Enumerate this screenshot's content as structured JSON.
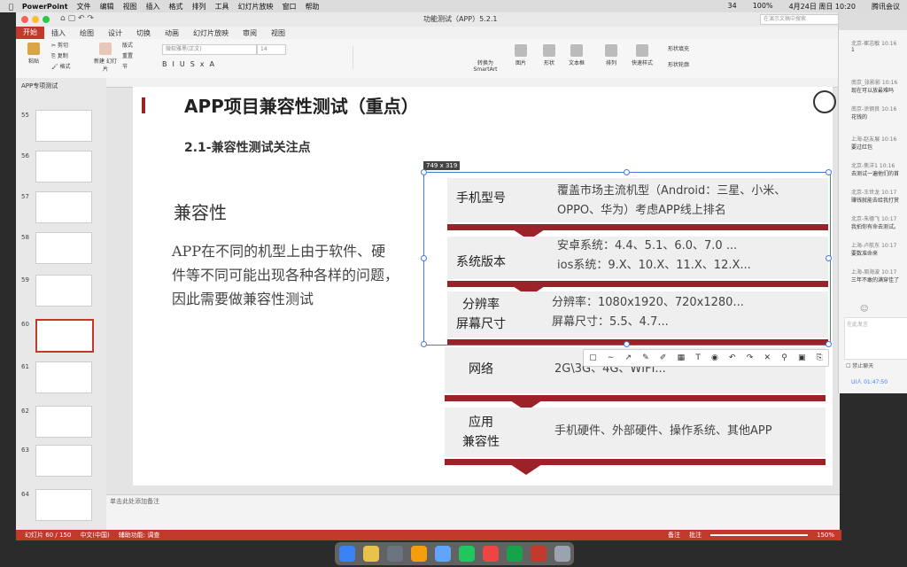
{
  "menubar": {
    "items": [
      "PowerPoint",
      "文件",
      "编辑",
      "视图",
      "插入",
      "格式",
      "排列",
      "工具",
      "幻灯片放映",
      "窗口",
      "帮助"
    ],
    "right": [
      "34",
      "100%",
      "4月24日 周日 10:20",
      "腾讯会议"
    ]
  },
  "window": {
    "title": "功能测试（APP）5.2.1",
    "search_placeholder": "在演示文稿中搜索"
  },
  "tabs": [
    "开始",
    "插入",
    "绘图",
    "设计",
    "切换",
    "动画",
    "幻灯片放映",
    "审阅",
    "视图"
  ],
  "ribbon": {
    "paste": "粘贴",
    "cut": "剪切",
    "copy": "复制",
    "format": "格式",
    "new_slide": "新建\n幻灯片",
    "layout": "版式",
    "reset": "重置",
    "section": "节",
    "font": "微软雅黑(正文)",
    "font_size": "14",
    "convert": "转换为\nSmartArt",
    "picture": "图片",
    "shape": "形状",
    "textbox": "文本框",
    "arrange": "排列",
    "quick_style": "快速样式",
    "shape_fill": "形状填充",
    "shape_outline": "形状轮廓"
  },
  "outline": {
    "title": "APP专项测试"
  },
  "thumbs": [
    "55",
    "56",
    "57",
    "58",
    "59",
    "60",
    "61",
    "62",
    "63",
    "64"
  ],
  "slide": {
    "title": "APP项目兼容性测试（重点）",
    "subtitle": "2.1-兼容性测试关注点",
    "heading": "兼容性",
    "body_lines": [
      "APP在不同的机型上由于软件、硬",
      "件等不同可能出现各种各样的问题，",
      "因此需要做兼容性测试"
    ],
    "rows": [
      {
        "label": [
          "手机型号"
        ],
        "desc": [
          "覆盖市场主流机型（Android：三星、小米、",
          "OPPO、华为）考虑APP线上排名"
        ]
      },
      {
        "label": [
          "系统版本"
        ],
        "desc": [
          "安卓系统：4.4、5.1、6.0、7.0 ...",
          "ios系统：9.X、10.X、11.X、12.X..."
        ]
      },
      {
        "label": [
          "分辨率",
          "屏幕尺寸"
        ],
        "desc": [
          "分辨率：1080x1920、720x1280...",
          "屏幕尺寸：5.5、4.7..."
        ]
      },
      {
        "label": [
          "网络"
        ],
        "desc": [
          "2G\\3G、4G、WIFI..."
        ]
      },
      {
        "label": [
          "应用",
          "兼容性"
        ],
        "desc": [
          "手机硬件、外部硬件、操作系统、其他APP"
        ]
      }
    ]
  },
  "capture": {
    "size_label": "749 x 319"
  },
  "notes": {
    "placeholder": "单击此处添加备注"
  },
  "status": {
    "slide": "幻灯片 60 / 150",
    "lang": "中文(中国)",
    "access": "辅助功能: 调查",
    "notes": "备注",
    "comments": "批注",
    "zoom": "150%"
  },
  "chat": {
    "messages": [
      {
        "user": "北京-崔志敏 10:16",
        "text": "1"
      },
      {
        "user": "南京_张影影 10:16",
        "text": "现在可以放最难吗"
      },
      {
        "user": "南京-涂钢良 10:16",
        "text": "花钱的"
      },
      {
        "user": "上海-赵友展 10:16",
        "text": "要过红包"
      },
      {
        "user": "北京-焦洋1 10:16",
        "text": "去测试一遍他们的首"
      },
      {
        "user": "北京-王世龙 10:17",
        "text": "赚钱就能去给我打赏"
      },
      {
        "user": "北京-朱德飞 10:17",
        "text": "我拍你有命去测试。"
      },
      {
        "user": "上海-卢航东 10:17",
        "text": "要数准命来"
      },
      {
        "user": "上海-周海波 10:17",
        "text": "三年不敢的满穿佳了"
      }
    ],
    "input_placeholder": "在此发言",
    "disable": "禁止聊天",
    "footer": "UI人 01:47:50"
  }
}
